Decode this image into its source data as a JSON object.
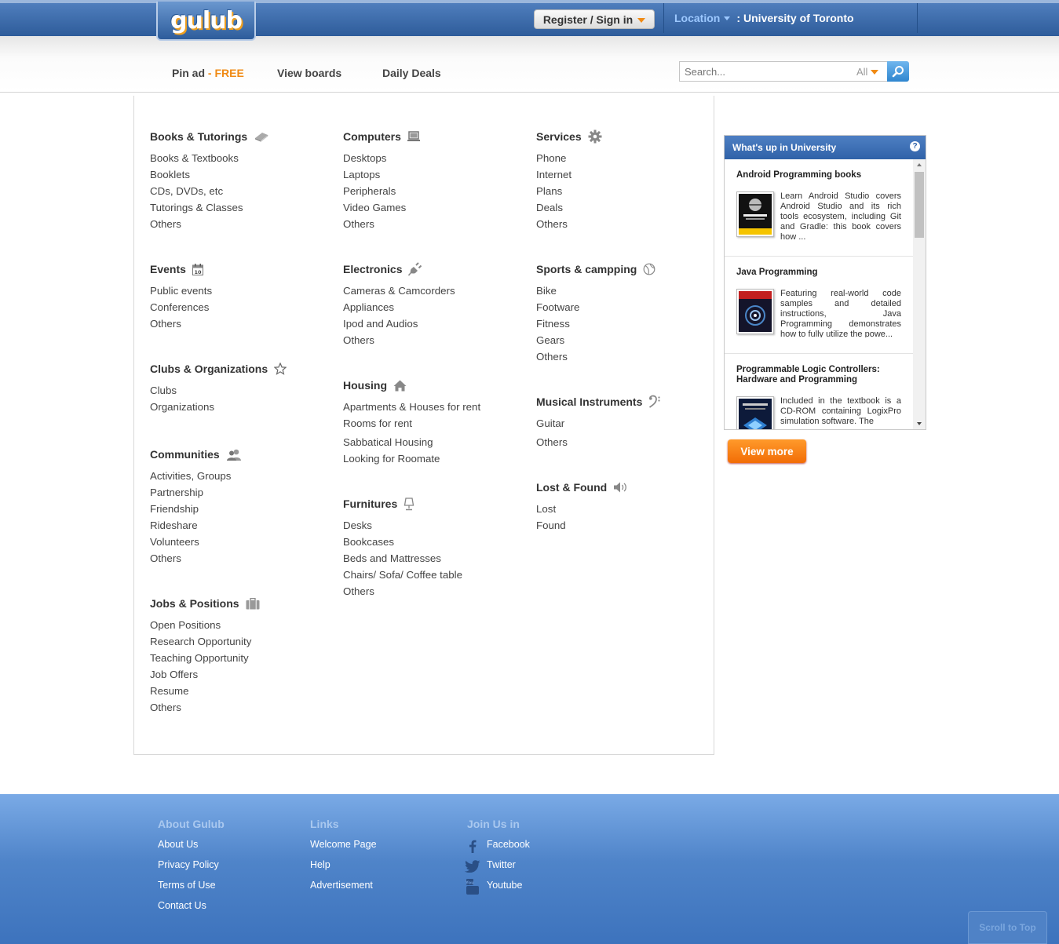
{
  "header": {
    "logo_text": "gulub",
    "register_label": "Register / Sign in",
    "location_label": "Location",
    "location_sep": ":",
    "location_value": "University of Toronto"
  },
  "nav": {
    "pin_ad": "Pin ad",
    "pin_ad_free": "- FREE",
    "view_boards": "View boards",
    "daily_deals": "Daily Deals",
    "search_placeholder": "Search...",
    "search_scope": "All"
  },
  "categories": {
    "books": {
      "title": "Books & Tutorings",
      "icon": "book-icon",
      "items": [
        "Books & Textbooks",
        "Booklets",
        "CDs, DVDs, etc",
        "Tutorings & Classes",
        "Others"
      ]
    },
    "events": {
      "title": "Events",
      "icon": "calendar-icon",
      "items": [
        "Public events",
        "Conferences",
        "Others"
      ]
    },
    "clubs": {
      "title": "Clubs & Organizations",
      "icon": "star-icon",
      "items": [
        "Clubs",
        "Organizations"
      ]
    },
    "communities": {
      "title": "Communities",
      "icon": "people-icon",
      "items": [
        "Activities, Groups",
        "Partnership",
        "Friendship",
        "Rideshare",
        "Volunteers",
        "Others"
      ]
    },
    "jobs": {
      "title": "Jobs & Positions",
      "icon": "briefcase-icon",
      "items": [
        "Open Positions",
        "Research Opportunity",
        "Teaching Opportunity",
        "Job Offers",
        "Resume",
        "Others"
      ]
    },
    "computers": {
      "title": "Computers",
      "icon": "laptop-icon",
      "items": [
        "Desktops",
        "Laptops",
        "Peripherals",
        "Video Games",
        "Others"
      ]
    },
    "electronics": {
      "title": "Electronics",
      "icon": "plug-icon",
      "items": [
        "Cameras & Camcorders",
        "Appliances",
        "Ipod and Audios",
        "Others"
      ]
    },
    "housing": {
      "title": "Housing",
      "icon": "home-icon",
      "items": [
        "Apartments & Houses for rent",
        "Rooms for rent",
        "Sabbatical Housing",
        "Looking for Roomate"
      ]
    },
    "furnitures": {
      "title": "Furnitures",
      "icon": "lamp-icon",
      "items": [
        "Desks",
        "Bookcases",
        "Beds and Mattresses",
        "Chairs/ Sofa/ Coffee table",
        "Others"
      ]
    },
    "services": {
      "title": "Services",
      "icon": "gear-icon",
      "items": [
        "Phone",
        "Internet",
        "Plans",
        "Deals",
        "Others"
      ]
    },
    "sports": {
      "title": "Sports & campping",
      "icon": "ball-icon",
      "items": [
        "Bike",
        "Footware",
        "Fitness",
        "Gears",
        "Others"
      ]
    },
    "music": {
      "title": "Musical Instruments",
      "icon": "bass-clef-icon",
      "items": [
        "Guitar",
        "Others"
      ]
    },
    "lostfound": {
      "title": "Lost & Found",
      "icon": "speaker-icon",
      "items": [
        "Lost",
        "Found"
      ]
    }
  },
  "widget": {
    "title": "What's up in University",
    "help": "?",
    "items": [
      {
        "title": "Android Programming books",
        "desc": "Learn Android Studio covers Android Studio and its rich tools ecosystem, including Git and Gradle: this book covers how ...",
        "thumb_color": "#111111"
      },
      {
        "title": "Java Programming",
        "desc": "Featuring real-world code samples and detailed instructions, Java Programming demonstrates how to fully utilize the powe...",
        "thumb_color": "#1a1a2e"
      },
      {
        "title": "Programmable Logic Controllers: Hardware and Programming",
        "desc": "Included in the textbook is a CD-ROM containing LogixPro simulation software. The",
        "thumb_color": "#0d1a3a"
      }
    ],
    "view_more": "View more"
  },
  "footer": {
    "about": {
      "title": "About Gulub",
      "links": [
        "About Us",
        "Privacy Policy",
        "Terms of Use",
        "Contact Us"
      ]
    },
    "links": {
      "title": "Links",
      "links": [
        "Welcome Page",
        "Help",
        "Advertisement"
      ]
    },
    "join": {
      "title": "Join Us in",
      "links": [
        "Facebook",
        "Twitter",
        "Youtube"
      ]
    },
    "scroll_top": "Scroll to Top"
  },
  "colors": {
    "accent_orange": "#f08a14",
    "header_blue": "#2e5c9a",
    "footer_blue": "#4f84c9"
  }
}
